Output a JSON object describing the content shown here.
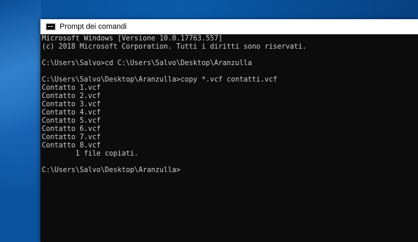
{
  "window": {
    "title": "Prompt dei comandi",
    "icon": "cmd-icon"
  },
  "console": {
    "lines": [
      "Microsoft Windows [Versione 10.0.17763.557]",
      "(c) 2018 Microsoft Corporation. Tutti i diritti sono riservati.",
      "",
      "C:\\Users\\Salvo>cd C:\\Users\\Salvo\\Desktop\\Aranzulla",
      "",
      "C:\\Users\\Salvo\\Desktop\\Aranzulla>copy *.vcf contatti.vcf",
      "Contatto 1.vcf",
      "Contatto 2.vcf",
      "Contatto 3.vcf",
      "Contatto 4.vcf",
      "Contatto 5.vcf",
      "Contatto 6.vcf",
      "Contatto 7.vcf",
      "Contatto 8.vcf",
      "        1 file copiati.",
      "",
      "C:\\Users\\Salvo\\Desktop\\Aranzulla>"
    ]
  },
  "colors": {
    "console_bg": "#0c0c0c",
    "console_fg": "#cccccc",
    "titlebar_bg": "#ffffff",
    "desktop_bg": "#0a4f98"
  }
}
